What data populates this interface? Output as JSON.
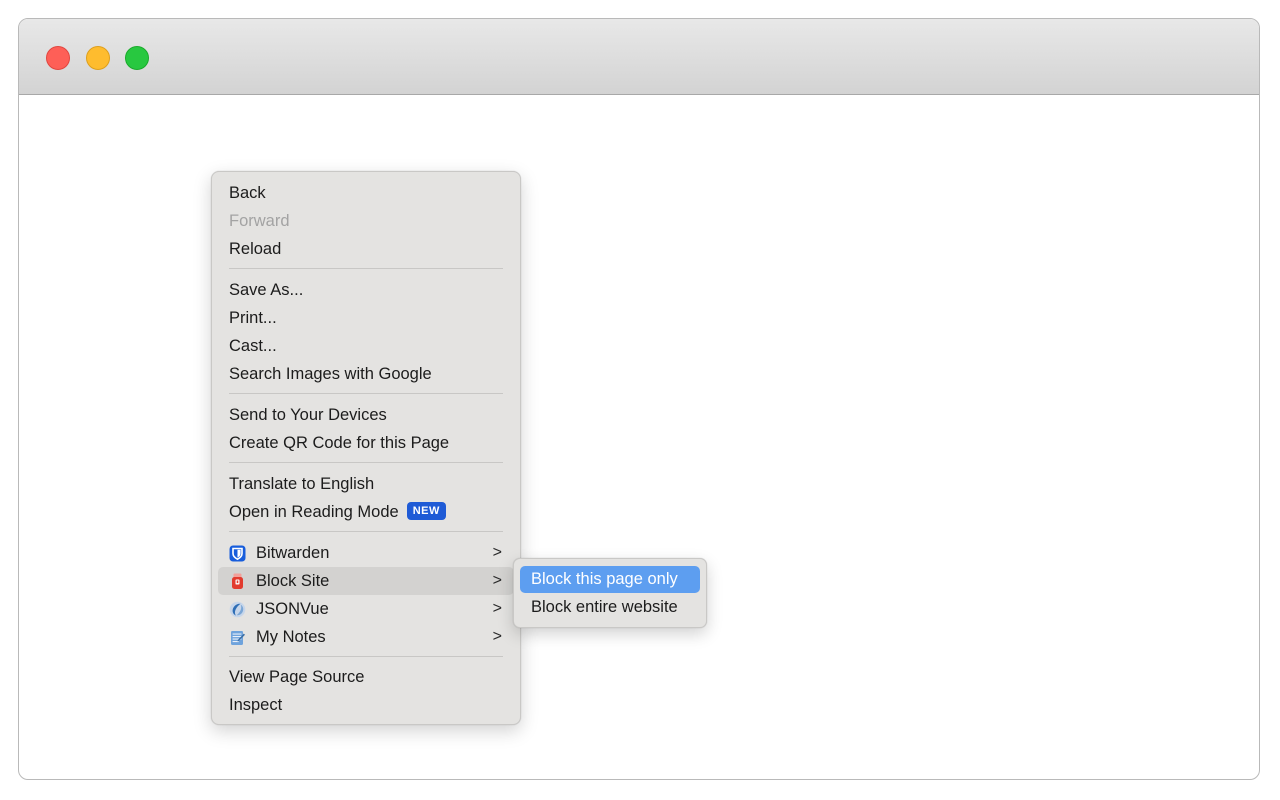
{
  "window": {
    "controls": [
      "close",
      "minimize",
      "zoom"
    ]
  },
  "context_menu": {
    "back": "Back",
    "forward": "Forward",
    "reload": "Reload",
    "save_as": "Save As...",
    "print": "Print...",
    "cast": "Cast...",
    "search_images": "Search Images with Google",
    "send_to_devices": "Send to Your Devices",
    "create_qr": "Create QR Code for this Page",
    "translate": "Translate to English",
    "reading_mode": "Open in Reading Mode",
    "reading_mode_badge": "NEW",
    "extensions": {
      "bitwarden": "Bitwarden",
      "block_site": "Block Site",
      "jsonvue": "JSONVue",
      "my_notes": "My Notes"
    },
    "chevron": ">",
    "view_source": "View Page Source",
    "inspect": "Inspect"
  },
  "submenu": {
    "block_page": "Block this page only",
    "block_website": "Block entire website"
  },
  "colors": {
    "highlight": "#5d9ef0",
    "badge": "#1f5bd6",
    "bitwarden": "#175ddc",
    "block_site": "#e23b2e"
  }
}
